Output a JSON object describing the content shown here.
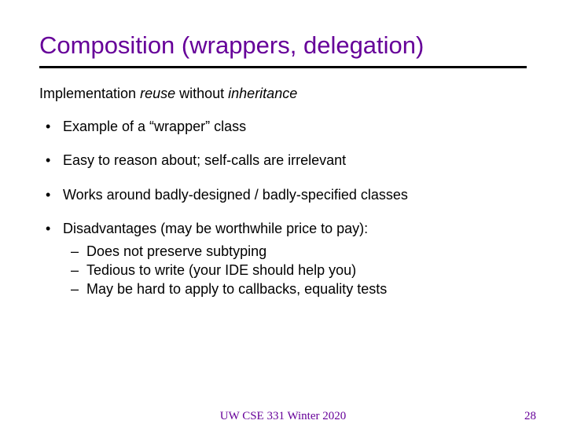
{
  "title": "Composition (wrappers, delegation)",
  "lead": {
    "pre": "Implementation ",
    "em1": "reuse",
    "mid": " without ",
    "em2": "inheritance"
  },
  "bullets": [
    {
      "text": "Example of a “wrapper” class"
    },
    {
      "text": "Easy to reason about; self-calls are irrelevant"
    },
    {
      "text": "Works around badly-designed / badly-specified classes"
    },
    {
      "text": "Disadvantages (may be worthwhile price to pay):",
      "sub": [
        "Does not preserve subtyping",
        "Tedious to write (your IDE should help you)",
        "May be hard to apply to callbacks, equality tests"
      ]
    }
  ],
  "footer": {
    "center": "UW CSE 331 Winter 2020",
    "page": "28"
  }
}
